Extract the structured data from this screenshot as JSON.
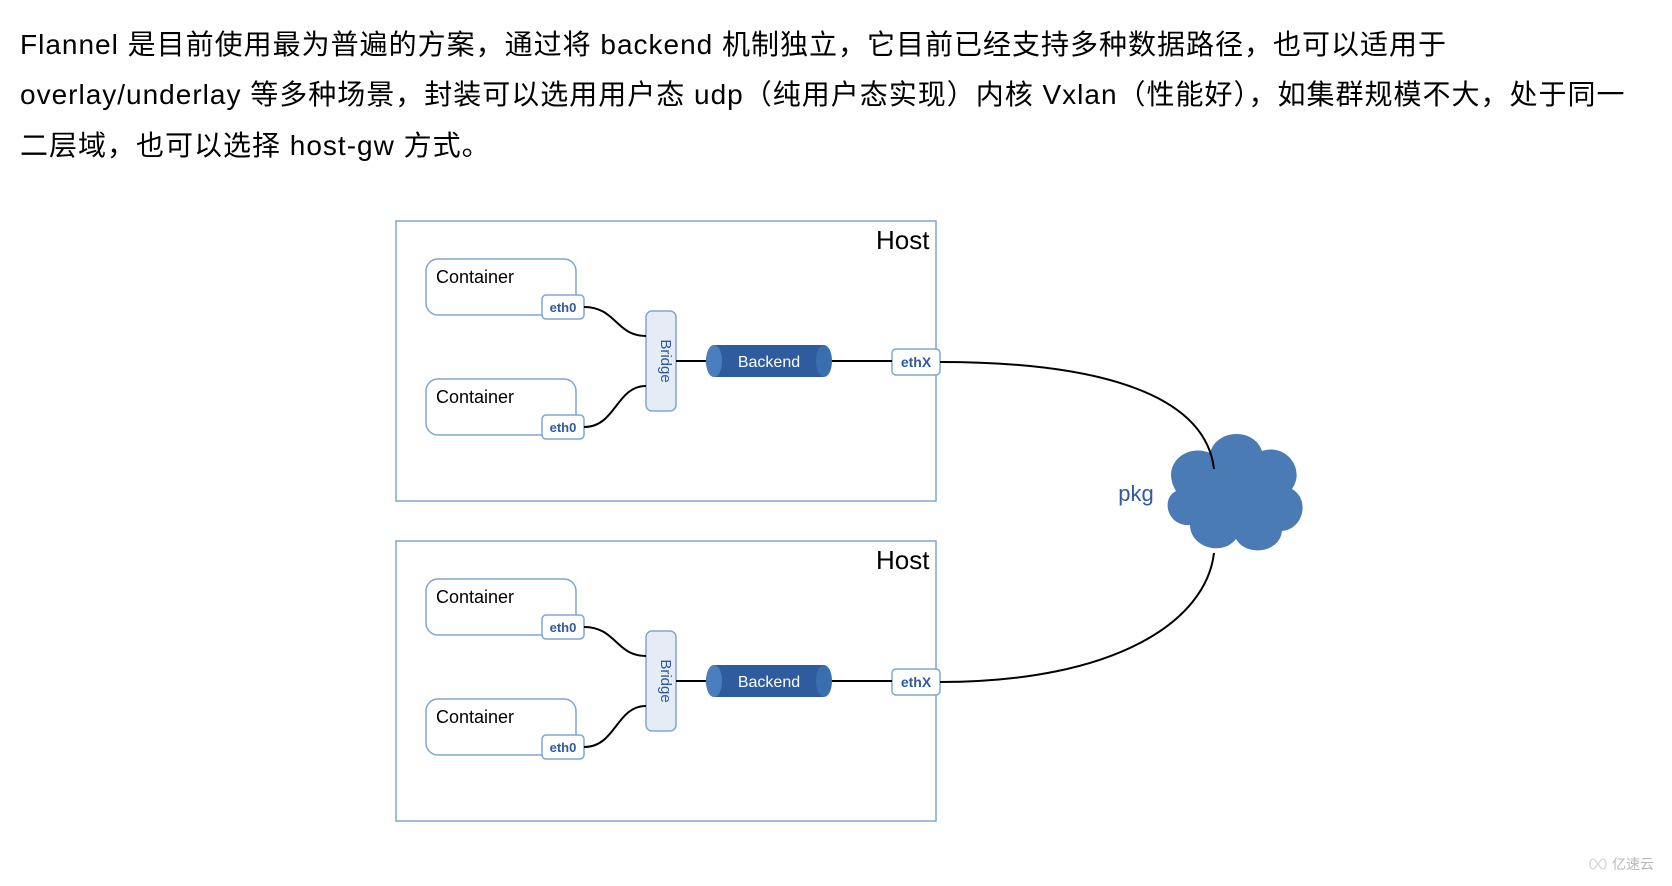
{
  "description_text": "Flannel 是目前使用最为普遍的方案，通过将 backend 机制独立，它目前已经支持多种数据路径，也可以适用于 overlay/underlay 等多种场景，封装可以选用用户态 udp（纯用户态实现）内核 Vxlan（性能好），如集群规模不大，处于同一二层域，也可以选择 host-gw 方式。",
  "diagram": {
    "hosts": [
      {
        "label": "Host",
        "containers": [
          {
            "label": "Container",
            "nic": "eth0"
          },
          {
            "label": "Container",
            "nic": "eth0"
          }
        ],
        "bridge_label": "Bridge",
        "backend_label": "Backend",
        "external_nic": "ethX"
      },
      {
        "label": "Host",
        "containers": [
          {
            "label": "Container",
            "nic": "eth0"
          },
          {
            "label": "Container",
            "nic": "eth0"
          }
        ],
        "bridge_label": "Bridge",
        "backend_label": "Backend",
        "external_nic": "ethX"
      }
    ],
    "cloud_label": "pkg"
  },
  "watermark": "亿速云",
  "colors": {
    "host_border": "#7FA6D2",
    "container_border": "#7FA6D2",
    "nic_border": "#7FA6D2",
    "nic_text": "#2E5C9E",
    "bridge_fill": "#E5ECF5",
    "bridge_border": "#7FA6D2",
    "bridge_text": "#2E5C9E",
    "backend_fill": "#2E5C9E",
    "backend_text": "#FFFFFF",
    "link_stroke": "#000000",
    "cloud_fill": "#4B7BB5",
    "cloud_label_text": "#2E5C9E"
  }
}
